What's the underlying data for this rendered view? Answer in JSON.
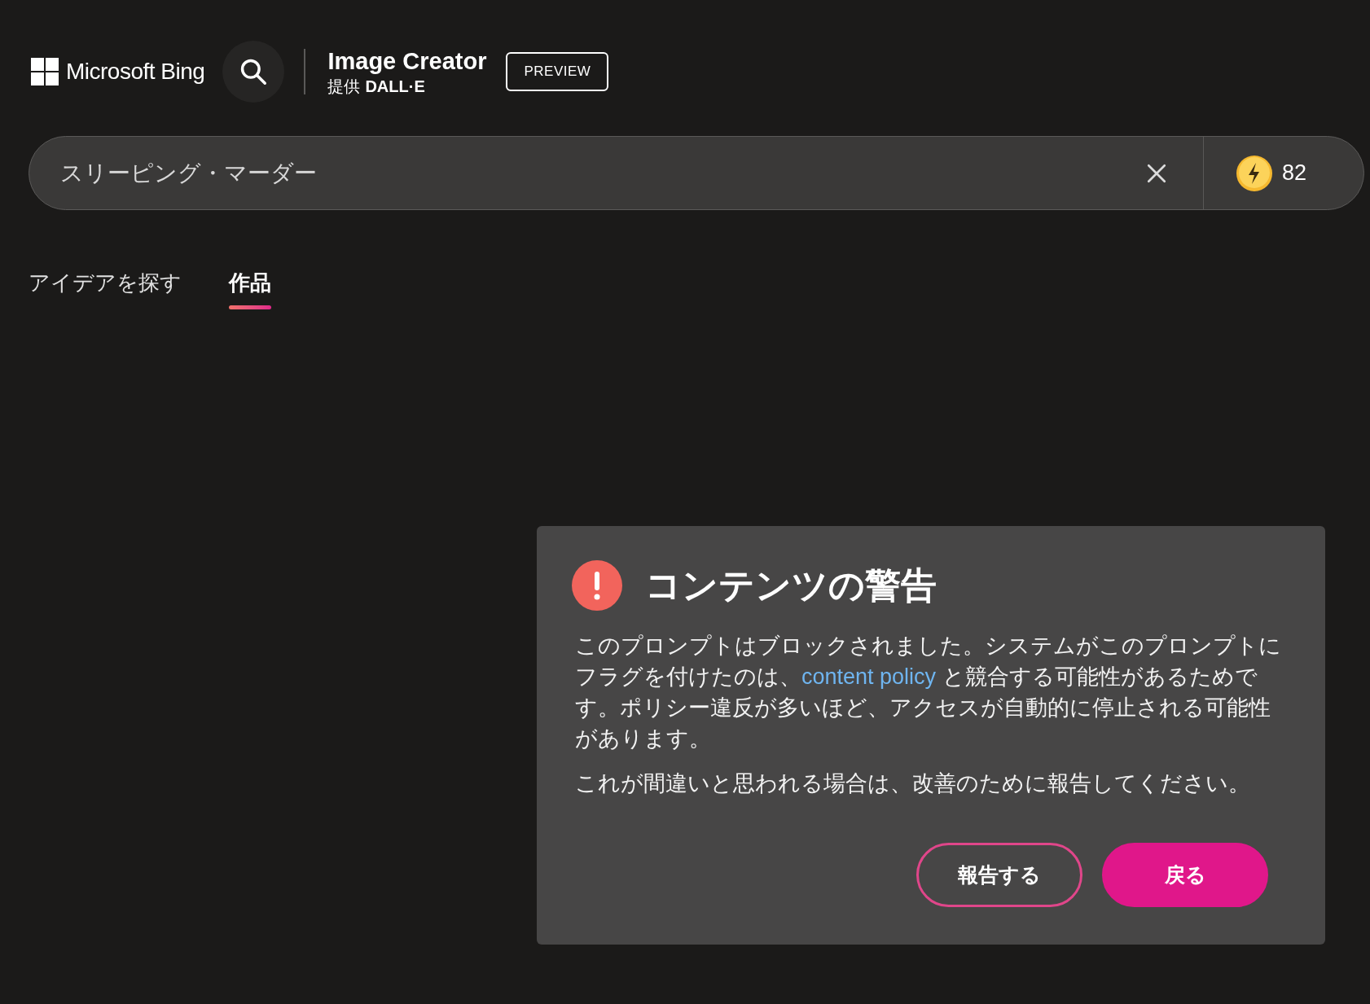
{
  "header": {
    "brand": "Microsoft Bing",
    "product": "Image Creator",
    "provider_label": "提供",
    "provider": "DALL·E",
    "badge": "PREVIEW"
  },
  "search": {
    "value": "スリーピング・マーダー",
    "boosts": "82"
  },
  "tabs": [
    {
      "label": "アイデアを探す",
      "selected": false
    },
    {
      "label": "作品",
      "selected": true
    }
  ],
  "dialog": {
    "title": "コンテンツの警告",
    "body_before": "このプロンプトはブロックされました。システムがこのプロンプトにフラグを付けたのは、",
    "body_link": "content policy",
    "body_after": " と競合する可能性があるためです。ポリシー違反が多いほど、アクセスが自動的に停止される可能性があります。",
    "note": "これが間違いと思われる場合は、改善のために報告してください。",
    "buttons": [
      {
        "label": "報告する",
        "kind": "outline"
      },
      {
        "label": "戻る",
        "kind": "primary"
      }
    ]
  }
}
